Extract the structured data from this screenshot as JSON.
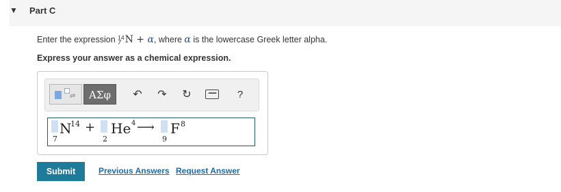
{
  "part": {
    "title": "Part C"
  },
  "prompt": {
    "before": "Enter the expression ",
    "nuclide_mass": "14",
    "nuclide_atomic": "7",
    "nuclide_symbol": "N",
    "plus": "+",
    "alpha_symbol": "α",
    "after": ", where ",
    "alpha_symbol_2": "α",
    "end": " is the lowercase Greek letter alpha."
  },
  "instruction": "Express your answer as a chemical expression.",
  "toolbar": {
    "templates_icon": "templates-icon",
    "greek_label": "ΑΣφ",
    "undo_icon": "↶",
    "redo_icon": "↷",
    "reset_icon": "↻",
    "keyboard_icon": "⌨",
    "help_label": "?"
  },
  "answer": {
    "t1_symbol": "N",
    "t1_super": "14",
    "t1_sub": "7",
    "op_plus": "+",
    "t2_symbol": "He",
    "t2_super": "4",
    "t2_sub": "2",
    "arrow": "⟶",
    "t3_symbol": "F",
    "t3_super": "8",
    "t3_sub": "9"
  },
  "actions": {
    "submit": "Submit",
    "previous_answers": "Previous Answers",
    "request_answer": "Request Answer"
  },
  "colors": {
    "accent": "#1e7b9a",
    "link": "#1f6aa5",
    "placeholder": "#cfe0f5"
  }
}
